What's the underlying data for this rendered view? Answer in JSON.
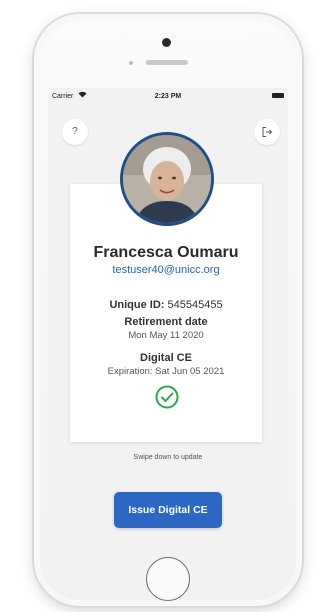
{
  "status_bar": {
    "carrier": "Carrier",
    "wifi_icon": "wifi-icon",
    "time": "2:23 PM",
    "battery_icon": "battery-icon"
  },
  "header": {
    "help_label": "?",
    "logout_icon": "logout-icon"
  },
  "profile": {
    "avatar_icon": "profile-photo",
    "name": "Francesca Oumaru",
    "email": "testuser40@unicc.org",
    "unique_id_label": "Unique ID:",
    "unique_id_value": "545545455",
    "retirement_label": "Retirement date",
    "retirement_value": "Mon May 11 2020",
    "ce_label": "Digital CE",
    "ce_expiration": "Expiration: Sat Jun 05 2021",
    "ce_status_icon": "check-circle-icon",
    "ce_status_color": "#2aa84a"
  },
  "hint": {
    "swipe_text": "Swipe down to update"
  },
  "actions": {
    "issue_label": "Issue Digital CE",
    "issue_color": "#2c67c4"
  }
}
